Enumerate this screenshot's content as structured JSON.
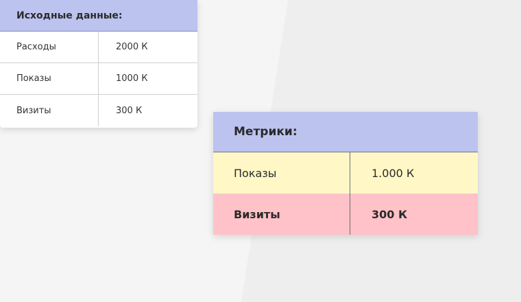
{
  "source_table": {
    "title": "Исходные данные:",
    "rows": [
      {
        "label": "Расходы",
        "value": "2000 К"
      },
      {
        "label": "Показы",
        "value": "1000 К"
      },
      {
        "label": "Визиты",
        "value": "300 К"
      }
    ]
  },
  "metrics_table": {
    "title": "Метрики:",
    "rows": [
      {
        "label": "Показы",
        "value": "1.000 К",
        "highlight": "#fff8c6"
      },
      {
        "label": "Визиты",
        "value": "300 К",
        "highlight": "#ffc2c8"
      }
    ]
  },
  "colors": {
    "header_bg": "#bcc3ef",
    "yellow_row": "#fff8c6",
    "pink_row": "#ffc2c8"
  }
}
